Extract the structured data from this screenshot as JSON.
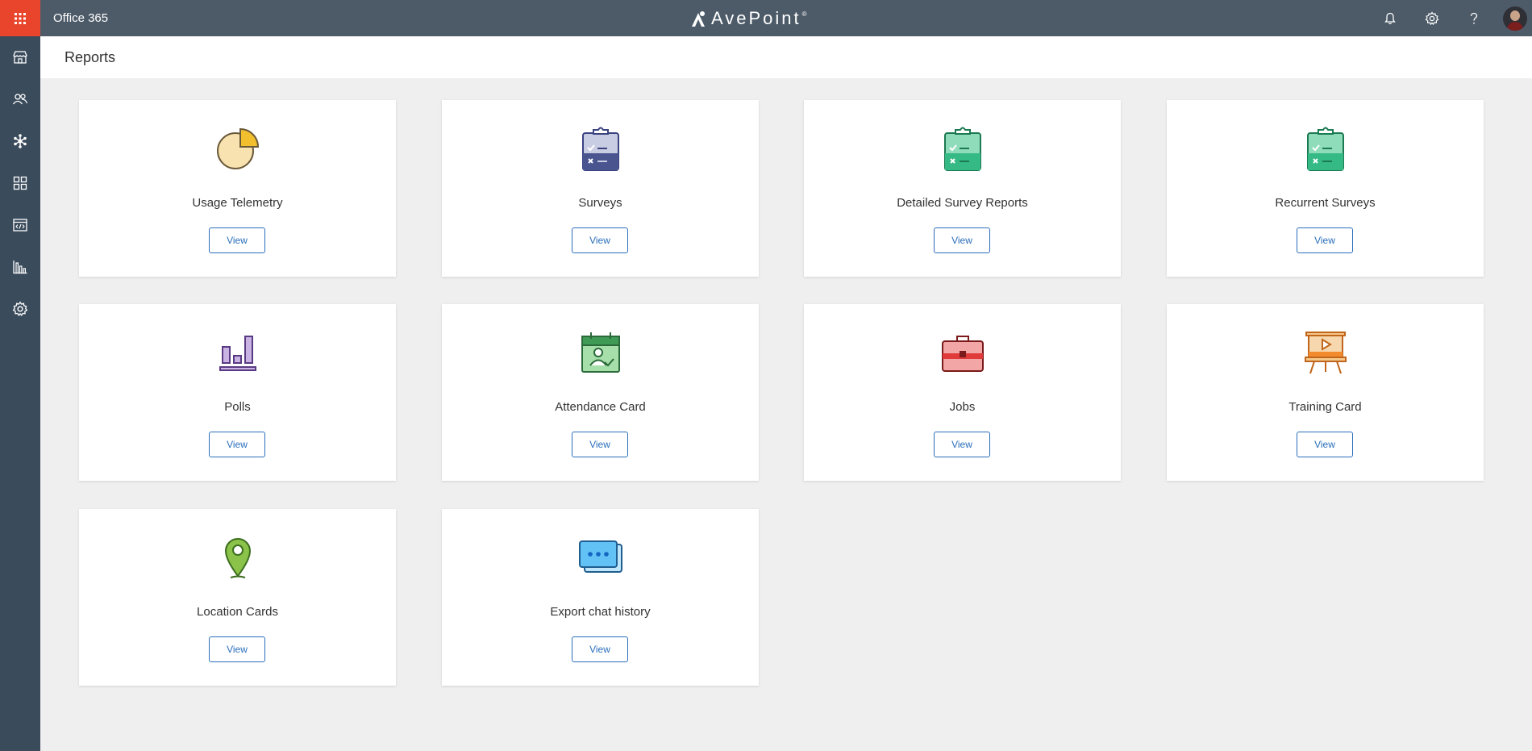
{
  "topbar": {
    "app_title": "Office 365",
    "brand": "AvePoint",
    "brand_mark": "®",
    "icons": [
      "bell-icon",
      "gear-icon",
      "help-icon",
      "avatar"
    ],
    "accent_color": "#e8452c",
    "bar_color": "#4d5b69"
  },
  "sidebar": {
    "color": "#3a4b5c",
    "items": [
      "store-icon",
      "people-icon",
      "network-icon",
      "apps-grid-icon",
      "code-card-icon",
      "reports-chart-icon",
      "settings-icon"
    ]
  },
  "page": {
    "title": "Reports"
  },
  "cards": [
    {
      "title": "Usage Telemetry",
      "icon": "pie-chart-icon",
      "button": "View"
    },
    {
      "title": "Surveys",
      "icon": "survey-clipboard-icon",
      "button": "View"
    },
    {
      "title": "Detailed Survey Reports",
      "icon": "survey-clipboard-icon",
      "button": "View"
    },
    {
      "title": "Recurrent Surveys",
      "icon": "survey-clipboard-icon",
      "button": "View"
    },
    {
      "title": "Polls",
      "icon": "poll-bars-icon",
      "button": "View"
    },
    {
      "title": "Attendance Card",
      "icon": "attendance-calendar-icon",
      "button": "View"
    },
    {
      "title": "Jobs",
      "icon": "briefcase-icon",
      "button": "View"
    },
    {
      "title": "Training Card",
      "icon": "presentation-easel-icon",
      "button": "View"
    },
    {
      "title": "Location Cards",
      "icon": "location-pin-icon",
      "button": "View"
    },
    {
      "title": "Export chat history",
      "icon": "chat-bubbles-icon",
      "button": "View"
    }
  ]
}
